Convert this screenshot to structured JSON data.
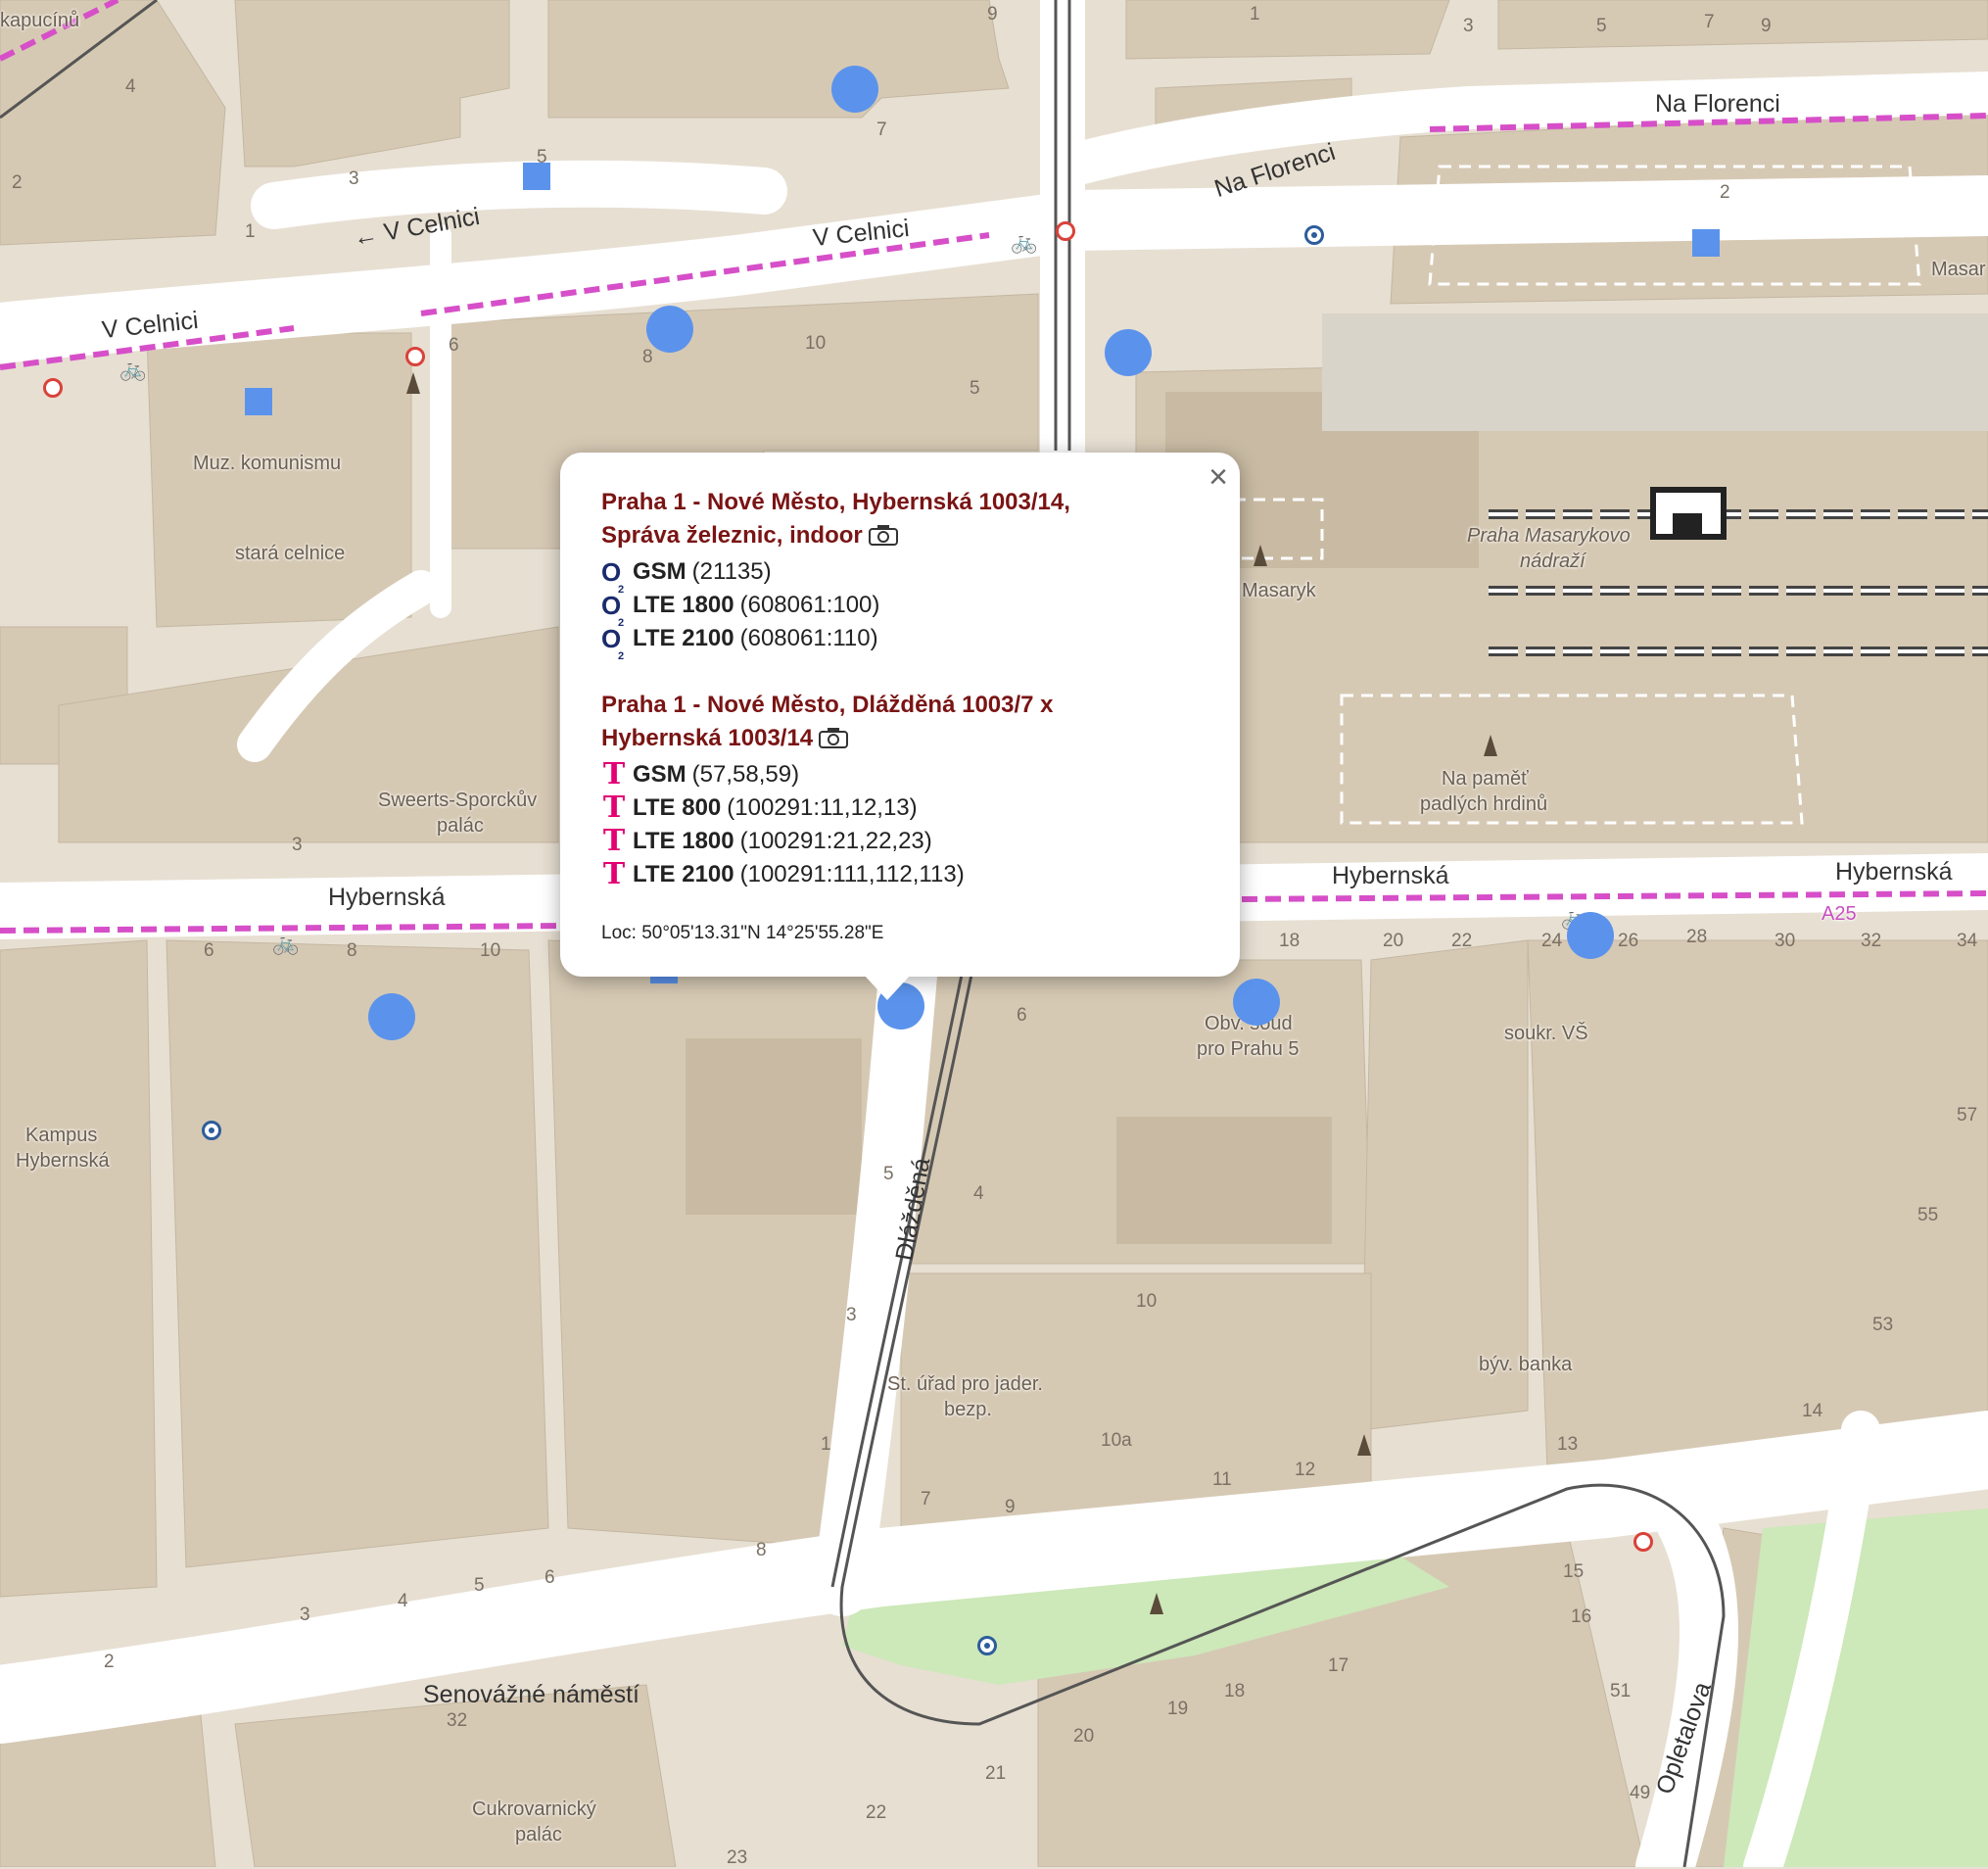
{
  "streets": {
    "v_celnici_1": "← V Celnici",
    "v_celnici_2": "V Celnici",
    "v_celnici_3": "V Celnici",
    "na_florenci_1": "Na Florenci",
    "na_florenci_2": "Na Florenci",
    "hybernska_1": "Hybernská",
    "hybernska_2": "Hybernská",
    "hybernska_3": "Hybernská",
    "dlazdena": "Dlážděná",
    "senovazne": "Senovážné náměstí",
    "opletalova": "Opletalova",
    "kapucinu": "kapucínů",
    "masar": "Masar",
    "a25": "A25"
  },
  "pois": {
    "muz_komunismu": "Muz. komunismu",
    "stara_celnice": "stará celnice",
    "praha_masarykovo_1": "Praha Masarykovo",
    "praha_masarykovo_2": "nádraží",
    "masaryk": "Masaryk",
    "na_pamet_1": "Na paměť",
    "na_pamet_2": "padlých hrdinů",
    "sweerts_1": "Sweerts-Sporckův",
    "sweerts_2": "palác",
    "obv_soud_1": "Obv. soud",
    "obv_soud_2": "pro Prahu 5",
    "soukr_vs": "soukr. VŠ",
    "kampus_1": "Kampus",
    "kampus_2": "Hybernská",
    "st_urad_1": "St. úřad pro jader.",
    "st_urad_2": "bezp.",
    "byv_banka": "býv. banka",
    "cukrovarnicky_1": "Cukrovarnický",
    "cukrovarnicky_2": "palác"
  },
  "house_numbers": [
    "4",
    "5",
    "3",
    "2",
    "1",
    "9",
    "7",
    "1",
    "3",
    "5",
    "7",
    "9",
    "2",
    "6",
    "8",
    "10",
    "5",
    "3",
    "6",
    "8",
    "10",
    "18",
    "20",
    "22",
    "24",
    "26",
    "28",
    "30",
    "32",
    "34",
    "6",
    "5",
    "4",
    "3",
    "1",
    "7",
    "8",
    "6",
    "5",
    "4",
    "3",
    "2",
    "32",
    "10",
    "10a",
    "11",
    "12",
    "9",
    "13",
    "14",
    "53",
    "55",
    "57",
    "15",
    "16",
    "17",
    "18",
    "19",
    "20",
    "21",
    "22",
    "23",
    "51",
    "49"
  ],
  "popup": {
    "close_glyph": "×",
    "sites": [
      {
        "title_line1": "Praha 1 - Nové Město, Hybernská 1003/14,",
        "title_line2": "Správa železnic, indoor",
        "operator": "O2",
        "rows": [
          {
            "tech": "GSM",
            "ids": "(21135)"
          },
          {
            "tech": "LTE 1800",
            "ids": "(608061:100)"
          },
          {
            "tech": "LTE 2100",
            "ids": "(608061:110)"
          }
        ]
      },
      {
        "title_line1": "Praha 1 - Nové Město, Dlážděná 1003/7 x",
        "title_line2": "Hybernská 1003/14",
        "operator": "T",
        "rows": [
          {
            "tech": "GSM",
            "ids": "(57,58,59)"
          },
          {
            "tech": "LTE 800",
            "ids": "(100291:11,12,13)"
          },
          {
            "tech": "LTE 1800",
            "ids": "(100291:21,22,23)"
          },
          {
            "tech": "LTE 2100",
            "ids": "(100291:111,112,113)"
          }
        ]
      }
    ],
    "loc": "Loc: 50°05'13.31\"N 14°25'55.28\"E"
  },
  "colors": {
    "building": "#d5c8b3",
    "block": "#e7dfd2",
    "road": "#ffffff",
    "park": "#cde8b9",
    "marker": "#5b93ec",
    "popup_title": "#7a1414",
    "o2": "#1a2b6d",
    "tmobile": "#e20074",
    "bike_lane": "#d64fc8"
  }
}
